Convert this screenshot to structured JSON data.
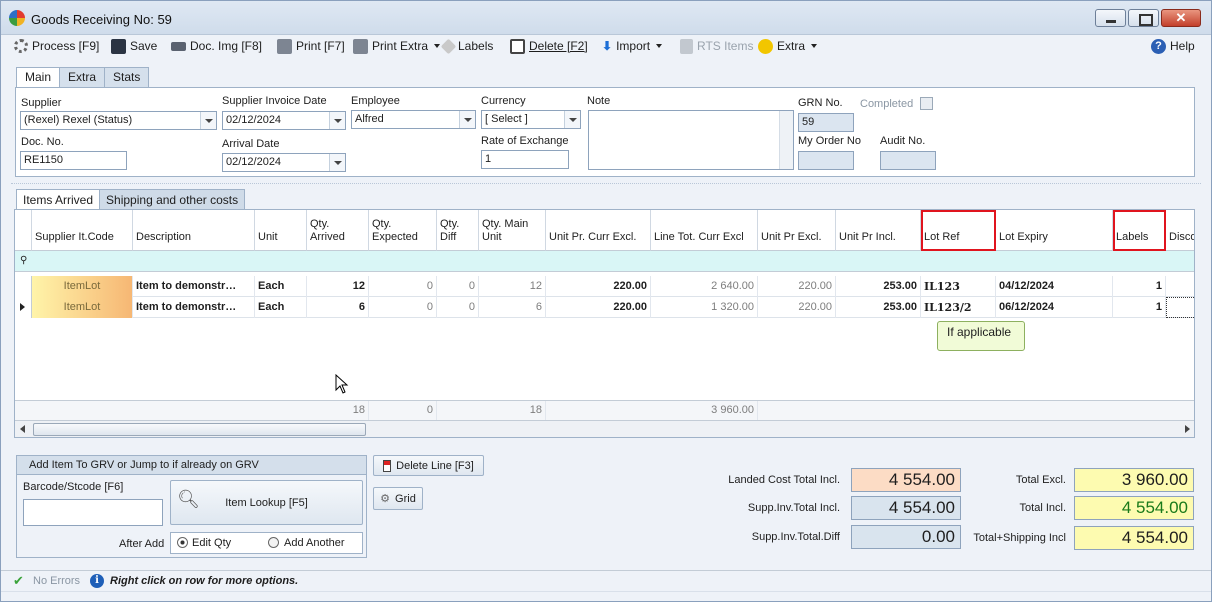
{
  "window": {
    "title": "Goods Receiving No: 59"
  },
  "toolbar": {
    "process": "Process [F9]",
    "save": "Save",
    "docimg": "Doc. Img [F8]",
    "print": "Print [F7]",
    "print_extra": "Print Extra",
    "labels": "Labels",
    "delete": "Delete [F2]",
    "import": "Import",
    "rts": "RTS Items",
    "extra": "Extra",
    "help": "Help"
  },
  "tabs": [
    "Main",
    "Extra",
    "Stats"
  ],
  "form": {
    "supplier_label": "Supplier",
    "supplier_value": "(Rexel) Rexel (Status)",
    "docno_label": "Doc. No.",
    "docno_value": "RE1150",
    "sid_label": "Supplier Invoice Date",
    "sid_value": "02/12/2024",
    "arrival_label": "Arrival Date",
    "arrival_value": "02/12/2024",
    "employee_label": "Employee",
    "employee_value": "Alfred",
    "currency_label": "Currency",
    "currency_value": "[ Select ]",
    "roe_label": "Rate of Exchange",
    "roe_value": "1",
    "note_label": "Note",
    "grn_label": "GRN No.",
    "grn_value": "59",
    "myorder_label": "My Order No",
    "audit_label": "Audit No.",
    "completed_label": "Completed"
  },
  "grid_tabs": [
    "Items Arrived",
    "Shipping and other costs"
  ],
  "grid": {
    "columns": [
      "Supplier It.Code",
      "Description",
      "Unit",
      "Qty.\nArrived",
      "Qty.\nExpected",
      "Qty.\nDiff",
      "Qty. Main\nUnit",
      "Unit Pr. Curr Excl.",
      "Line Tot. Curr Excl",
      "Unit Pr Excl.",
      "Unit Pr Incl.",
      "Lot Ref",
      "Lot Expiry",
      "Labels",
      "Disco"
    ],
    "rows": [
      [
        "ItemLot",
        "Item to demonstr…",
        "Each",
        "12",
        "0",
        "0",
        "12",
        "220.00",
        "2 640.00",
        "220.00",
        "253.00",
        "IL123",
        "04/12/2024",
        "1"
      ],
      [
        "ItemLot",
        "Item to demonstr…",
        "Each",
        "6",
        "0",
        "0",
        "6",
        "220.00",
        "1 320.00",
        "220.00",
        "253.00",
        "IL123/2",
        "06/12/2024",
        "1"
      ]
    ],
    "footer": {
      "arrived": "18",
      "expected": "0",
      "main_unit": "18",
      "line_total": "3 960.00"
    },
    "tooltip": "If applicable"
  },
  "add": {
    "header": "Add Item To GRV or Jump to if already on GRV",
    "barcode_label": "Barcode/Stcode [F6]",
    "lookup": "Item Lookup [F5]",
    "after_add": "After Add",
    "edit_qty": "Edit Qty",
    "add_another": "Add Another"
  },
  "buttons": {
    "delete_line": "Delete Line [F3]",
    "grid": "Grid"
  },
  "totals": {
    "landed_label": "Landed Cost Total Incl.",
    "landed": "4 554.00",
    "supp_incl_label": "Supp.Inv.Total Incl.",
    "supp_incl": "4 554.00",
    "supp_diff_label": "Supp.Inv.Total.Diff",
    "supp_diff": "0.00",
    "excl_label": "Total Excl.",
    "excl": "3 960.00",
    "incl_label": "Total Incl.",
    "incl": "4 554.00",
    "ship_label": "Total+Shipping Incl",
    "ship": "4 554.00"
  },
  "status": {
    "errors": "No Errors",
    "hint": "Right click on row for more options."
  }
}
